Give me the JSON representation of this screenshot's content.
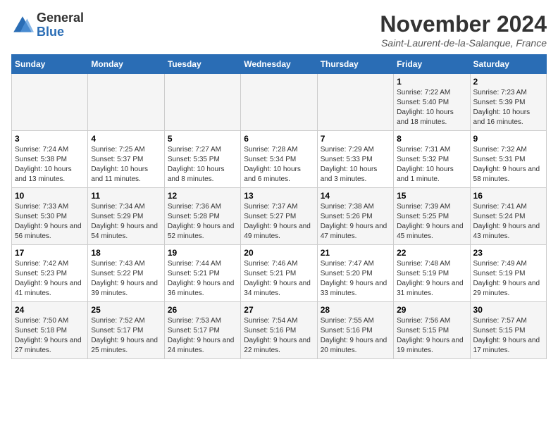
{
  "header": {
    "logo_line1": "General",
    "logo_line2": "Blue",
    "month_title": "November 2024",
    "location": "Saint-Laurent-de-la-Salanque, France"
  },
  "weekdays": [
    "Sunday",
    "Monday",
    "Tuesday",
    "Wednesday",
    "Thursday",
    "Friday",
    "Saturday"
  ],
  "weeks": [
    [
      {
        "day": "",
        "info": ""
      },
      {
        "day": "",
        "info": ""
      },
      {
        "day": "",
        "info": ""
      },
      {
        "day": "",
        "info": ""
      },
      {
        "day": "",
        "info": ""
      },
      {
        "day": "1",
        "info": "Sunrise: 7:22 AM\nSunset: 5:40 PM\nDaylight: 10 hours and 18 minutes."
      },
      {
        "day": "2",
        "info": "Sunrise: 7:23 AM\nSunset: 5:39 PM\nDaylight: 10 hours and 16 minutes."
      }
    ],
    [
      {
        "day": "3",
        "info": "Sunrise: 7:24 AM\nSunset: 5:38 PM\nDaylight: 10 hours and 13 minutes."
      },
      {
        "day": "4",
        "info": "Sunrise: 7:25 AM\nSunset: 5:37 PM\nDaylight: 10 hours and 11 minutes."
      },
      {
        "day": "5",
        "info": "Sunrise: 7:27 AM\nSunset: 5:35 PM\nDaylight: 10 hours and 8 minutes."
      },
      {
        "day": "6",
        "info": "Sunrise: 7:28 AM\nSunset: 5:34 PM\nDaylight: 10 hours and 6 minutes."
      },
      {
        "day": "7",
        "info": "Sunrise: 7:29 AM\nSunset: 5:33 PM\nDaylight: 10 hours and 3 minutes."
      },
      {
        "day": "8",
        "info": "Sunrise: 7:31 AM\nSunset: 5:32 PM\nDaylight: 10 hours and 1 minute."
      },
      {
        "day": "9",
        "info": "Sunrise: 7:32 AM\nSunset: 5:31 PM\nDaylight: 9 hours and 58 minutes."
      }
    ],
    [
      {
        "day": "10",
        "info": "Sunrise: 7:33 AM\nSunset: 5:30 PM\nDaylight: 9 hours and 56 minutes."
      },
      {
        "day": "11",
        "info": "Sunrise: 7:34 AM\nSunset: 5:29 PM\nDaylight: 9 hours and 54 minutes."
      },
      {
        "day": "12",
        "info": "Sunrise: 7:36 AM\nSunset: 5:28 PM\nDaylight: 9 hours and 52 minutes."
      },
      {
        "day": "13",
        "info": "Sunrise: 7:37 AM\nSunset: 5:27 PM\nDaylight: 9 hours and 49 minutes."
      },
      {
        "day": "14",
        "info": "Sunrise: 7:38 AM\nSunset: 5:26 PM\nDaylight: 9 hours and 47 minutes."
      },
      {
        "day": "15",
        "info": "Sunrise: 7:39 AM\nSunset: 5:25 PM\nDaylight: 9 hours and 45 minutes."
      },
      {
        "day": "16",
        "info": "Sunrise: 7:41 AM\nSunset: 5:24 PM\nDaylight: 9 hours and 43 minutes."
      }
    ],
    [
      {
        "day": "17",
        "info": "Sunrise: 7:42 AM\nSunset: 5:23 PM\nDaylight: 9 hours and 41 minutes."
      },
      {
        "day": "18",
        "info": "Sunrise: 7:43 AM\nSunset: 5:22 PM\nDaylight: 9 hours and 39 minutes."
      },
      {
        "day": "19",
        "info": "Sunrise: 7:44 AM\nSunset: 5:21 PM\nDaylight: 9 hours and 36 minutes."
      },
      {
        "day": "20",
        "info": "Sunrise: 7:46 AM\nSunset: 5:21 PM\nDaylight: 9 hours and 34 minutes."
      },
      {
        "day": "21",
        "info": "Sunrise: 7:47 AM\nSunset: 5:20 PM\nDaylight: 9 hours and 33 minutes."
      },
      {
        "day": "22",
        "info": "Sunrise: 7:48 AM\nSunset: 5:19 PM\nDaylight: 9 hours and 31 minutes."
      },
      {
        "day": "23",
        "info": "Sunrise: 7:49 AM\nSunset: 5:19 PM\nDaylight: 9 hours and 29 minutes."
      }
    ],
    [
      {
        "day": "24",
        "info": "Sunrise: 7:50 AM\nSunset: 5:18 PM\nDaylight: 9 hours and 27 minutes."
      },
      {
        "day": "25",
        "info": "Sunrise: 7:52 AM\nSunset: 5:17 PM\nDaylight: 9 hours and 25 minutes."
      },
      {
        "day": "26",
        "info": "Sunrise: 7:53 AM\nSunset: 5:17 PM\nDaylight: 9 hours and 24 minutes."
      },
      {
        "day": "27",
        "info": "Sunrise: 7:54 AM\nSunset: 5:16 PM\nDaylight: 9 hours and 22 minutes."
      },
      {
        "day": "28",
        "info": "Sunrise: 7:55 AM\nSunset: 5:16 PM\nDaylight: 9 hours and 20 minutes."
      },
      {
        "day": "29",
        "info": "Sunrise: 7:56 AM\nSunset: 5:15 PM\nDaylight: 9 hours and 19 minutes."
      },
      {
        "day": "30",
        "info": "Sunrise: 7:57 AM\nSunset: 5:15 PM\nDaylight: 9 hours and 17 minutes."
      }
    ]
  ]
}
